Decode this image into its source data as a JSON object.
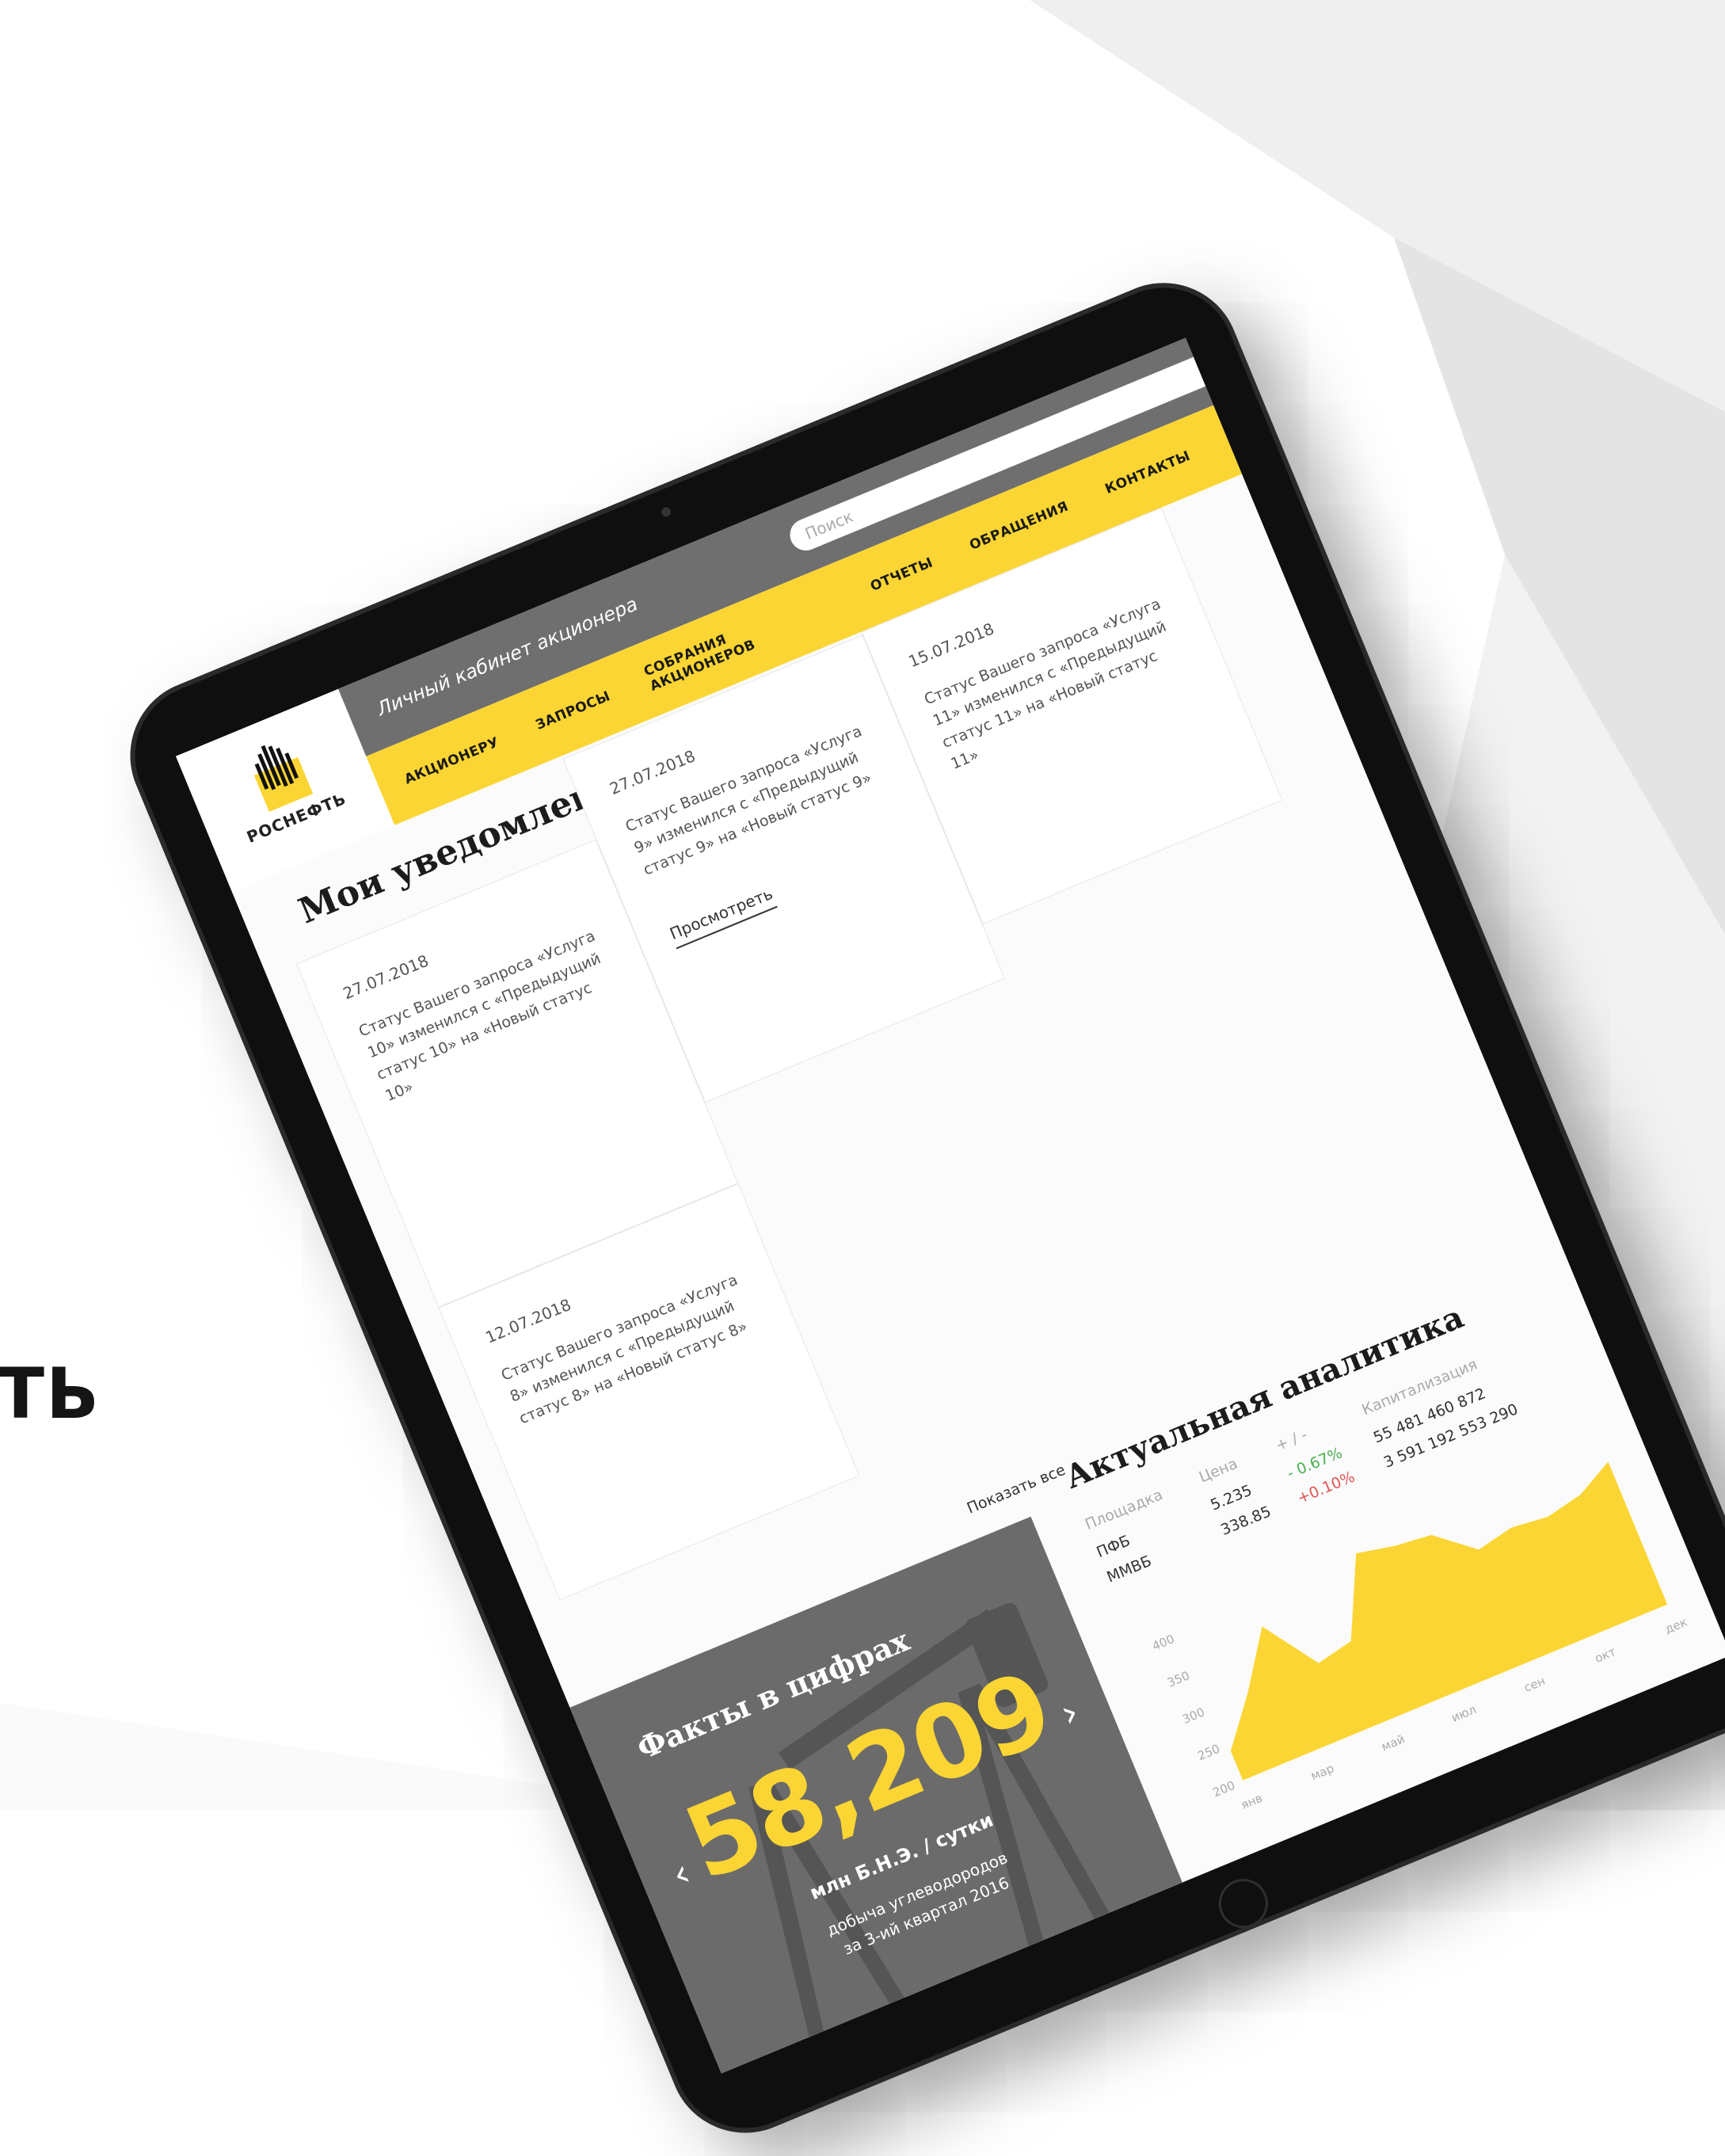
{
  "background": {
    "side_word": "ТЬ"
  },
  "header": {
    "logo_text": "РОСНЕФТЬ",
    "cabinet_title": "Личный кабинет акционера",
    "search_placeholder": "Поиск",
    "nav": [
      "АКЦИОНЕРУ",
      "ЗАПРОСЫ",
      "СОБРАНИЯ АКЦИОНЕРОВ",
      "ОТЧЕТЫ",
      "ОБРАЩЕНИЯ",
      "КОНТАКТЫ"
    ]
  },
  "notifications": {
    "title": "Мои уведомления",
    "cards": [
      {
        "date": "27.07.2018",
        "text": "Статус Вашего запроса «Услуга 10» изменился с «Предыдущий статус 10» на «Новый статус 10»"
      },
      {
        "date": "27.07.2018",
        "text": "Статус Вашего запроса «Услуга 9» изменился с «Предыдущий статус 9» на «Новый статус 9»",
        "link": "Просмотреть"
      },
      {
        "date": "15.07.2018",
        "text": "Статус Вашего запроса «Услуга 11» изменился с «Предыдущий статус 11» на «Новый статус 11»"
      },
      {
        "date": "12.07.2018",
        "text": "Статус Вашего запроса «Услуга 8» изменился с «Предыдущий статус 8» на «Новый статус 8»"
      }
    ],
    "show_all": "Показать все"
  },
  "facts": {
    "title": "Факты в цифрах",
    "number": "58,209",
    "unit": "млн Б.Н.Э. / сутки",
    "description_line1": "добыча углеводородов",
    "description_line2": "за 3-ий квартал 2016",
    "prev": "‹",
    "next": "›"
  },
  "analytics": {
    "title": "Актуальная аналитика",
    "columns": [
      "Площадка",
      "Цена",
      "+ / -",
      "Капитализация"
    ],
    "rows": [
      {
        "venue": "ПФБ",
        "price": "5.235",
        "change": "- 0.67%",
        "cap": "55 481 460 872"
      },
      {
        "venue": "ММВБ",
        "price": "338.85",
        "change": "+0.10%",
        "cap": "3 591 192 553 290"
      }
    ]
  },
  "chart_data": {
    "type": "area",
    "categories": [
      "янв",
      "мар",
      "май",
      "июл",
      "сен",
      "окт",
      "дек"
    ],
    "y_ticks": [
      200,
      250,
      300,
      350,
      400
    ],
    "ylim": [
      200,
      430
    ],
    "x": [
      0,
      0.5,
      1,
      1.5,
      2,
      2.5,
      3,
      3.5,
      4,
      4.5,
      5,
      5.5,
      6
    ],
    "values": [
      240,
      300,
      370,
      300,
      310,
      410,
      400,
      395,
      355,
      365,
      360,
      370,
      395
    ],
    "color": "#fbd533"
  },
  "colors": {
    "brand_yellow": "#fbd533",
    "header_gray": "#6f6f6f",
    "facts_bg": "#6b6b6b",
    "negative": "#4caf50",
    "positive": "#e05555"
  }
}
